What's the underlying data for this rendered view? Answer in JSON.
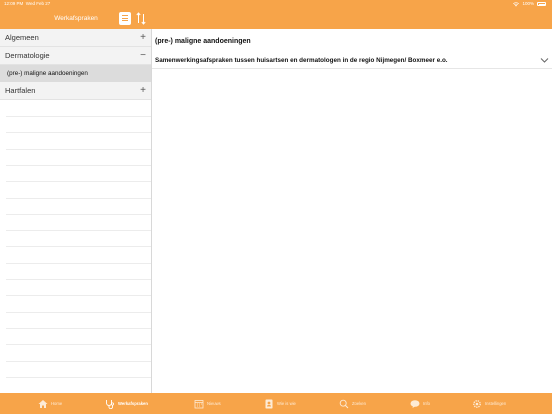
{
  "statusbar": {
    "time": "12:09 PM",
    "date": "Wed Feb 27",
    "battery": "100%"
  },
  "sidebar": {
    "title": "Werkafspraken",
    "categories": [
      {
        "label": "Algemeen",
        "sign": "+"
      },
      {
        "label": "Dermatologie",
        "sign": "−"
      },
      {
        "label": "Hartfalen",
        "sign": "+"
      }
    ],
    "selected_item": "(pre-) maligne aandoeningen"
  },
  "main": {
    "title": "(pre-) maligne aandoeningen",
    "accordion_label": "Samenwerkingsafspraken tussen huisartsen en dermatologen in de regio Nijmegen/ Boxmeer e.o."
  },
  "tabs": [
    {
      "label": "Home",
      "icon": "home-icon"
    },
    {
      "label": "Werkafspraken",
      "icon": "stethoscope-icon",
      "active": true
    },
    {
      "label": "Nieuws",
      "icon": "calendar-icon"
    },
    {
      "label": "Wie is wie",
      "icon": "contact-card-icon"
    },
    {
      "label": "Zoeken",
      "icon": "search-icon"
    },
    {
      "label": "Info",
      "icon": "chat-bubble-icon"
    },
    {
      "label": "Instellingen",
      "icon": "gear-icon"
    }
  ],
  "colors": {
    "accent": "#f7a449",
    "selected_row": "#dcdcdc",
    "category_bg": "#f3f3f3"
  }
}
